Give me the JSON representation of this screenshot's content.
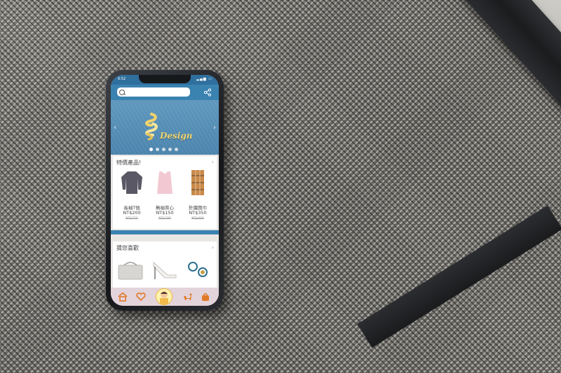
{
  "status_bar": {
    "time": "6:52"
  },
  "search": {
    "placeholder": ""
  },
  "banner": {
    "brand": "Design",
    "slide_count": 5,
    "active_slide": 0
  },
  "sale_section": {
    "title": "特價產品!",
    "products": [
      {
        "name": "長袖T恤",
        "price": "NT$200",
        "old_price": "NT$250"
      },
      {
        "name": "無袖背心",
        "price": "NT$150",
        "old_price": "NT$200"
      },
      {
        "name": "針織圍巾",
        "price": "NT$350",
        "old_price": "NT$400"
      }
    ]
  },
  "recommend_section": {
    "title": "猜您喜歡"
  },
  "nav": {
    "items": [
      "home-icon",
      "heart-icon",
      "avatar",
      "pet-icon",
      "bag-icon"
    ]
  },
  "colors": {
    "primary": "#3a82b0",
    "banner": "#4b84ad",
    "logo_yellow": "#f1d36b",
    "nav_bg": "#e3d3da",
    "nav_icon": "#e07a2a"
  }
}
